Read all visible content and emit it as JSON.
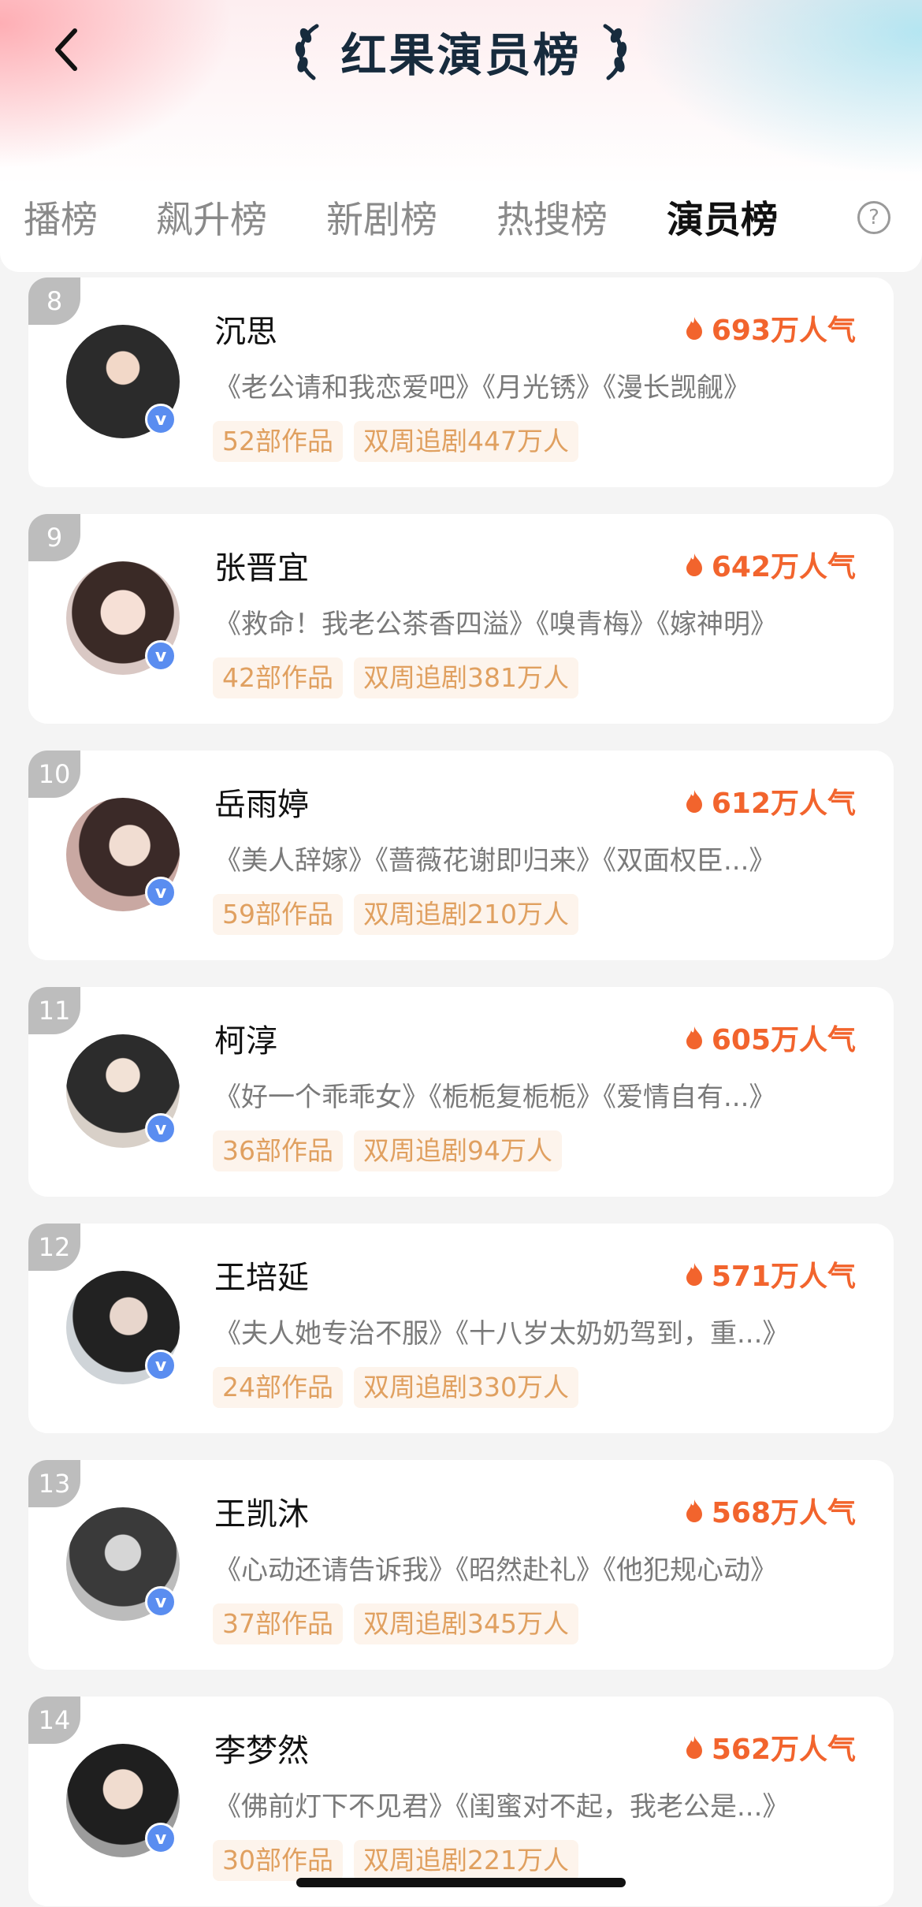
{
  "header": {
    "title": "红果演员榜",
    "tabs": [
      {
        "label": "播榜",
        "active": false
      },
      {
        "label": "飙升榜",
        "active": false
      },
      {
        "label": "新剧榜",
        "active": false
      },
      {
        "label": "热搜榜",
        "active": false
      },
      {
        "label": "演员榜",
        "active": true
      }
    ],
    "help_symbol": "?"
  },
  "colors": {
    "accent": "#f2642d",
    "tag_text": "#e0a060",
    "tag_bg": "#fdf4ec",
    "verified": "#5a8df0"
  },
  "verified_mark": "v",
  "actors": [
    {
      "rank": "8",
      "name": "沉思",
      "popularity": "693万人气",
      "works": "《老公请和我恋爱吧》《月光锈》《漫长觊觎》",
      "count": "52部作品",
      "followers": "双周追剧447万人"
    },
    {
      "rank": "9",
      "name": "张晋宜",
      "popularity": "642万人气",
      "works": "《救命！我老公茶香四溢》《嗅青梅》《嫁神明》",
      "count": "42部作品",
      "followers": "双周追剧381万人"
    },
    {
      "rank": "10",
      "name": "岳雨婷",
      "popularity": "612万人气",
      "works": "《美人辞嫁》《蔷薇花谢即归来》《双面权臣...》",
      "count": "59部作品",
      "followers": "双周追剧210万人"
    },
    {
      "rank": "11",
      "name": "柯淳",
      "popularity": "605万人气",
      "works": "《好一个乖乖女》《栀栀复栀栀》《爱情自有...》",
      "count": "36部作品",
      "followers": "双周追剧94万人"
    },
    {
      "rank": "12",
      "name": "王培延",
      "popularity": "571万人气",
      "works": "《夫人她专治不服》《十八岁太奶奶驾到，重...》",
      "count": "24部作品",
      "followers": "双周追剧330万人"
    },
    {
      "rank": "13",
      "name": "王凯沐",
      "popularity": "568万人气",
      "works": "《心动还请告诉我》《昭然赴礼》《他犯规心动》",
      "count": "37部作品",
      "followers": "双周追剧345万人"
    },
    {
      "rank": "14",
      "name": "李梦然",
      "popularity": "562万人气",
      "works": "《佛前灯下不见君》《闺蜜对不起，我老公是...》",
      "count": "30部作品",
      "followers": "双周追剧221万人"
    }
  ]
}
